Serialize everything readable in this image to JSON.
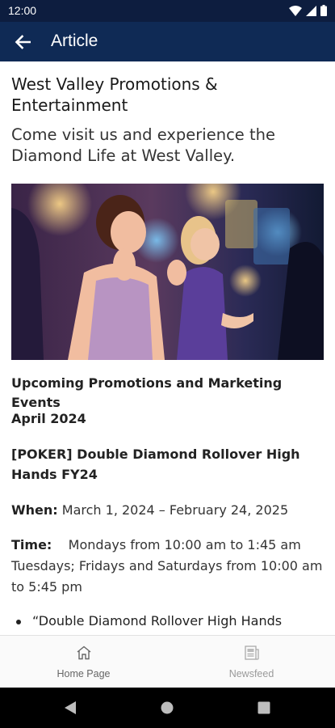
{
  "status_bar": {
    "time": "12:00"
  },
  "app_bar": {
    "title": "Article",
    "back_icon": "arrow-left-icon"
  },
  "article": {
    "title": "West Valley Promotions & Entertainment",
    "subtitle": "Come visit us and experience the Diamond Life at West Valley.",
    "section_heading": "Upcoming Promotions and Marketing Events",
    "month": "April 2024",
    "event_title": "[POKER] Double Diamond Rollover High Hands FY24",
    "when_label": "When:",
    "when_value": "March 1, 2024 – February 24, 2025",
    "time_label": "Time:",
    "time_value": "Mondays from 10:00 am to 1:45 am Tuesdays; Fridays and Saturdays from 10:00 am to 5:45 pm",
    "bullet_text": "“Double Diamond Rollover High Hands"
  },
  "bottom_nav": {
    "items": [
      {
        "label": "Home Page",
        "icon": "home-icon",
        "active": true
      },
      {
        "label": "Newsfeed",
        "icon": "newsfeed-icon",
        "active": false
      }
    ]
  },
  "colors": {
    "status_bar": "#0d1d3f",
    "app_bar": "#0f2a55"
  }
}
